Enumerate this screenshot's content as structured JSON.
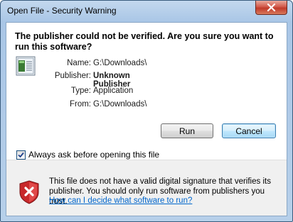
{
  "window": {
    "title": "Open File - Security Warning"
  },
  "heading": "The publisher could not be verified.  Are you sure you want to run this software?",
  "details": [
    {
      "label": "Name:",
      "value": "G:\\Downloads\\",
      "bold": false
    },
    {
      "label": "Publisher:",
      "value": "Unknown Publisher",
      "bold": true
    },
    {
      "label": "Type:",
      "value": "Application",
      "bold": false
    },
    {
      "label": "From:",
      "value": "G:\\Downloads\\",
      "bold": false
    }
  ],
  "buttons": {
    "run": "Run",
    "cancel": "Cancel"
  },
  "checkbox": {
    "label": "Always ask before opening this file",
    "checked": true
  },
  "warning": {
    "text": "This file does not have a valid digital signature that verifies its publisher.  You should only run software from publishers you trust.",
    "link": "How can I decide what software to run?"
  },
  "icons": {
    "close": "close-icon",
    "file": "application-file-icon",
    "shield": "security-shield-icon"
  },
  "colors": {
    "close_button": "#c13a2a",
    "link": "#0066cc",
    "shield": "#c8282a"
  }
}
